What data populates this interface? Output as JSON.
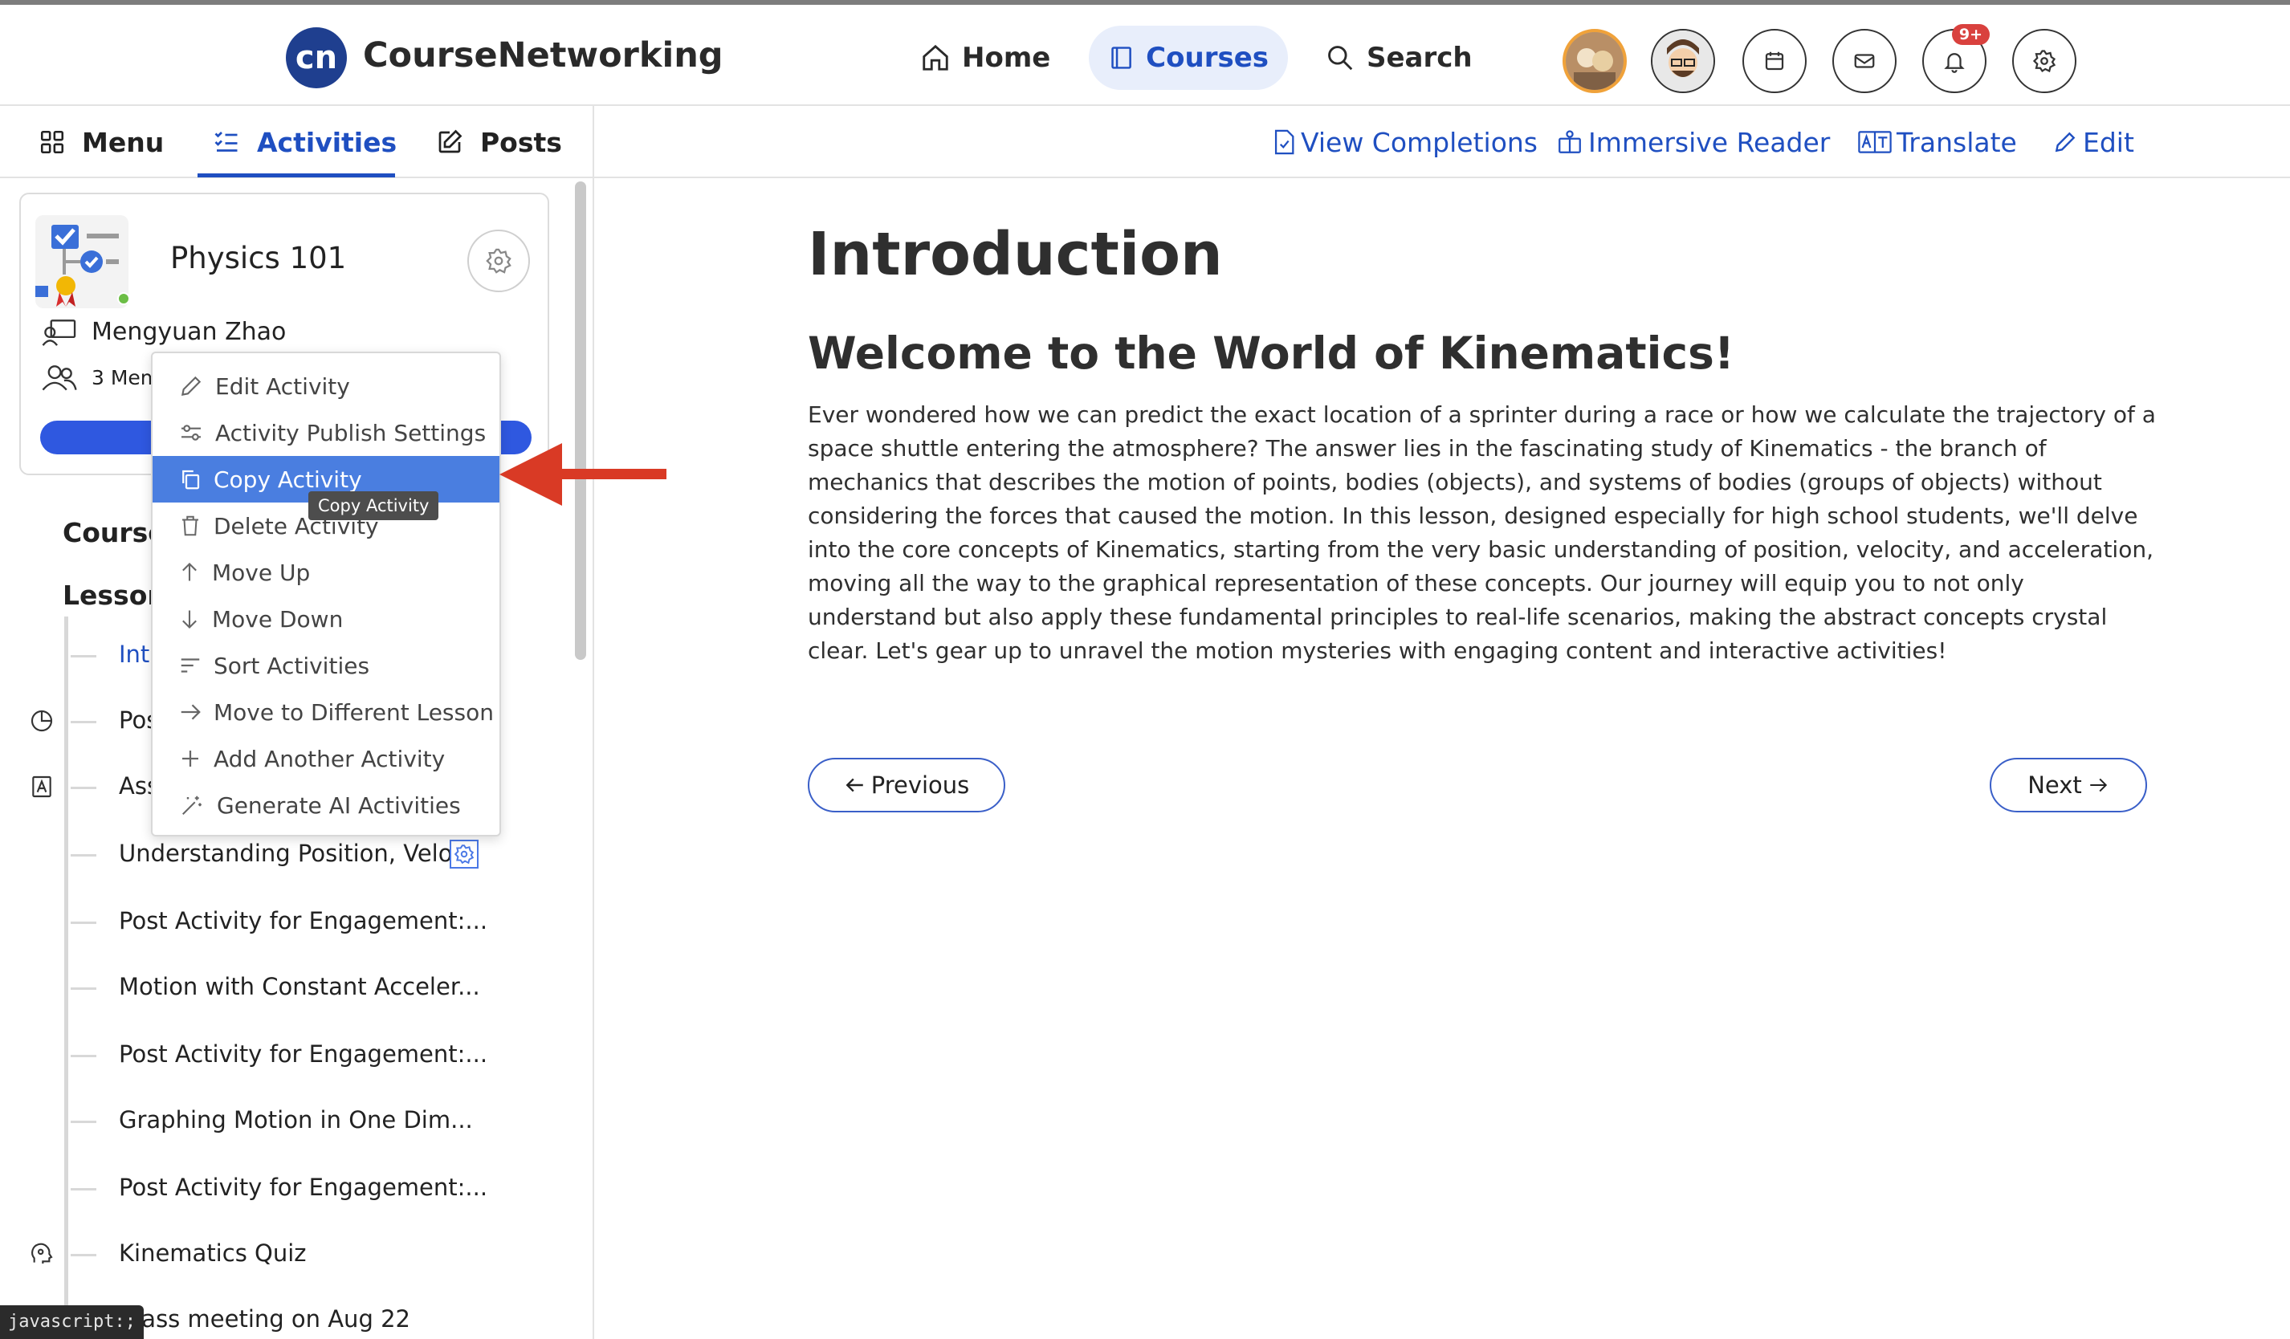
{
  "header": {
    "logo_text": "cn",
    "brand": "CourseNetworking",
    "nav": {
      "home": "Home",
      "courses": "Courses",
      "search": "Search"
    },
    "notification_badge": "9+"
  },
  "subnav": {
    "menu": "Menu",
    "activities": "Activities",
    "posts": "Posts",
    "actions": {
      "view_completions": "View Completions",
      "immersive_reader": "Immersive Reader",
      "translate": "Translate",
      "edit": "Edit"
    }
  },
  "course_card": {
    "title": "Physics 101",
    "instructor": "Mengyuan Zhao",
    "members": "3 Mem"
  },
  "sidebar": {
    "section_course": "Course",
    "section_lesson": "Lesson",
    "items": [
      "Int",
      "Pos",
      "Ass",
      "Understanding Position, Velo...",
      "Post Activity for Engagement:...",
      "Motion with Constant Acceler...",
      "Post Activity for Engagement:...",
      "Graphing Motion in One Dim...",
      "Post Activity for Engagement:...",
      "Kinematics Quiz",
      "Class meeting on Aug 22"
    ]
  },
  "context_menu": {
    "items": [
      "Edit Activity",
      "Activity Publish Settings",
      "Copy Activity",
      "Delete Activity",
      "Move Up",
      "Move Down",
      "Sort Activities",
      "Move to Different Lesson",
      "Add Another Activity",
      "Generate AI Activities"
    ],
    "tooltip": "Copy Activity"
  },
  "main": {
    "title": "Introduction",
    "subtitle": "Welcome to the World of Kinematics!",
    "body": "Ever wondered how we can predict the exact location of a sprinter during a race or how we calculate the trajectory of a space shuttle entering the atmosphere? The answer lies in the fascinating study of Kinematics - the branch of mechanics that describes the motion of points, bodies (objects), and systems of bodies (groups of objects) without considering the forces that caused the motion. In this lesson, designed especially for high school students, we'll delve into the core concepts of Kinematics, starting from the very basic understanding of position, velocity, and acceleration, moving all the way to the graphical representation of these concepts. Our journey will equip you to not only understand but also apply these fundamental principles to real-life scenarios, making the abstract concepts crystal clear. Let's gear up to unravel the motion mysteries with engaging content and interactive activities!",
    "previous": "Previous",
    "next": "Next"
  },
  "status_bar": "javascript:;",
  "colors": {
    "accent": "#1f4fc1",
    "menu_highlight": "#4a7ee0",
    "arrow": "#d93a25",
    "badge": "#d9413e"
  }
}
